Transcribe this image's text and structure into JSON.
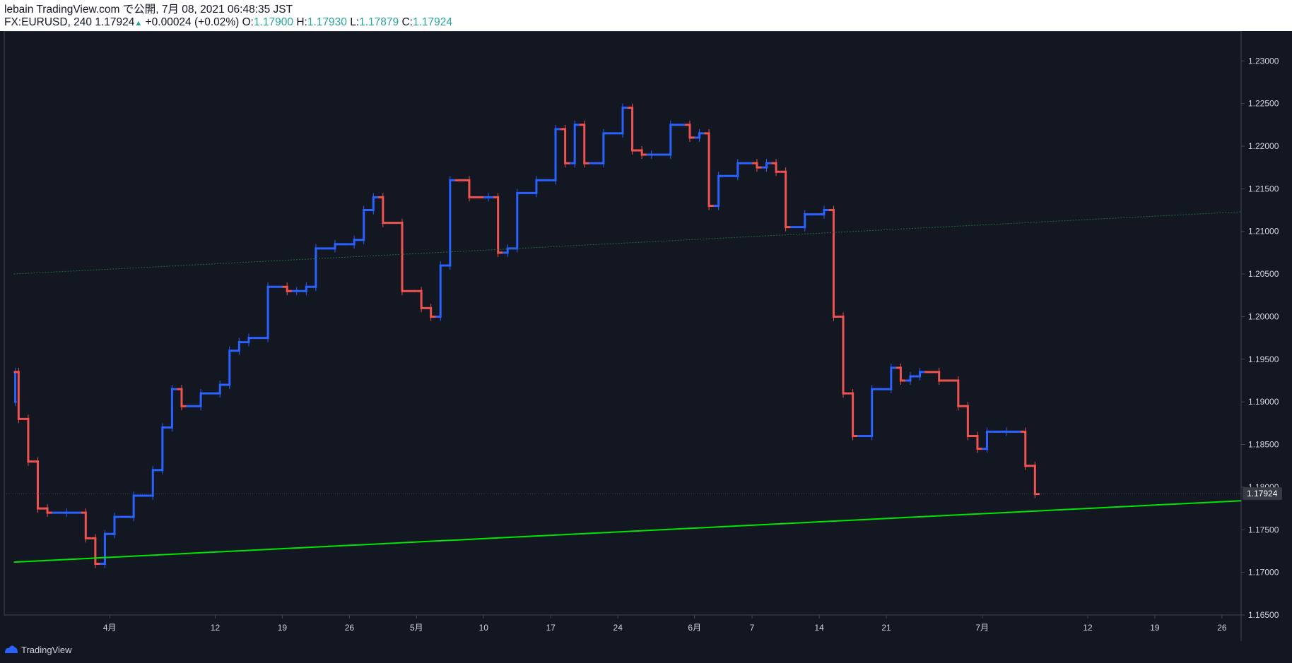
{
  "header": {
    "published": "lebain TradingView.com で公開, 7月 08, 2021 06:48:35 JST",
    "symbol": "FX:EURUSD, 240",
    "last": "1.17924",
    "change": "+0.00024 (+0.02%)",
    "o_label": "O:",
    "o_value": "1.17900",
    "h_label": "H:",
    "h_value": "1.17930",
    "l_label": "L:",
    "l_value": "1.17879",
    "c_label": "C:",
    "c_value": "1.17924"
  },
  "footer": {
    "brand": "TradingView",
    "logo_icon": "tradingview-logo-icon"
  },
  "colors": {
    "background": "#131722",
    "up": "#2962ff",
    "down": "#ef5350",
    "trendline": "#00e600",
    "reference_line": "#1e6b3a",
    "axis_text": "#d1d4dc",
    "price_label_bg": "#363a45"
  },
  "chart_data": {
    "type": "candlestick",
    "symbol": "FX:EURUSD",
    "interval": "240",
    "last_price": "1.17924",
    "ylim": [
      1.165,
      1.2335
    ],
    "x_ticks": [
      {
        "label": "4月",
        "date": "2021-04-01"
      },
      {
        "label": "12",
        "date": "2021-04-12"
      },
      {
        "label": "19",
        "date": "2021-04-19"
      },
      {
        "label": "26",
        "date": "2021-04-26"
      },
      {
        "label": "5月",
        "date": "2021-05-03"
      },
      {
        "label": "10",
        "date": "2021-05-10"
      },
      {
        "label": "17",
        "date": "2021-05-17"
      },
      {
        "label": "24",
        "date": "2021-05-24"
      },
      {
        "label": "6月",
        "date": "2021-06-01"
      },
      {
        "label": "7",
        "date": "2021-06-07"
      },
      {
        "label": "14",
        "date": "2021-06-14"
      },
      {
        "label": "21",
        "date": "2021-06-21"
      },
      {
        "label": "7月",
        "date": "2021-07-01"
      },
      {
        "label": "12",
        "date": "2021-07-12"
      },
      {
        "label": "19",
        "date": "2021-07-19"
      },
      {
        "label": "26",
        "date": "2021-07-26"
      }
    ],
    "y_ticks": [
      "1.23000",
      "1.22500",
      "1.22000",
      "1.21500",
      "1.21000",
      "1.20500",
      "1.20000",
      "1.19500",
      "1.19000",
      "1.18500",
      "1.18000",
      "1.17500",
      "1.17000",
      "1.16500"
    ],
    "price_path": [
      [
        "2021-03-22",
        1.19
      ],
      [
        "2021-03-22",
        1.1935
      ],
      [
        "2021-03-23",
        1.188
      ],
      [
        "2021-03-24",
        1.183
      ],
      [
        "2021-03-25",
        1.1775
      ],
      [
        "2021-03-26",
        1.177
      ],
      [
        "2021-03-29",
        1.177
      ],
      [
        "2021-03-30",
        1.174
      ],
      [
        "2021-03-31",
        1.171
      ],
      [
        "2021-04-01",
        1.1745
      ],
      [
        "2021-04-02",
        1.1765
      ],
      [
        "2021-04-05",
        1.179
      ],
      [
        "2021-04-06",
        1.182
      ],
      [
        "2021-04-07",
        1.187
      ],
      [
        "2021-04-08",
        1.1915
      ],
      [
        "2021-04-09",
        1.1895
      ],
      [
        "2021-04-12",
        1.191
      ],
      [
        "2021-04-13",
        1.192
      ],
      [
        "2021-04-14",
        1.196
      ],
      [
        "2021-04-15",
        1.197
      ],
      [
        "2021-04-16",
        1.1975
      ],
      [
        "2021-04-19",
        1.2035
      ],
      [
        "2021-04-20",
        1.203
      ],
      [
        "2021-04-21",
        1.203
      ],
      [
        "2021-04-22",
        1.2035
      ],
      [
        "2021-04-23",
        1.208
      ],
      [
        "2021-04-26",
        1.2085
      ],
      [
        "2021-04-27",
        1.209
      ],
      [
        "2021-04-28",
        1.2125
      ],
      [
        "2021-04-29",
        1.214
      ],
      [
        "2021-04-30",
        1.211
      ],
      [
        "2021-05-03",
        1.203
      ],
      [
        "2021-05-04",
        1.201
      ],
      [
        "2021-05-05",
        1.2
      ],
      [
        "2021-05-06",
        1.206
      ],
      [
        "2021-05-07",
        1.216
      ],
      [
        "2021-05-10",
        1.214
      ],
      [
        "2021-05-11",
        1.214
      ],
      [
        "2021-05-12",
        1.2075
      ],
      [
        "2021-05-13",
        1.208
      ],
      [
        "2021-05-14",
        1.2145
      ],
      [
        "2021-05-17",
        1.216
      ],
      [
        "2021-05-18",
        1.222
      ],
      [
        "2021-05-19",
        1.218
      ],
      [
        "2021-05-20",
        1.2225
      ],
      [
        "2021-05-21",
        1.218
      ],
      [
        "2021-05-24",
        1.2215
      ],
      [
        "2021-05-25",
        1.2245
      ],
      [
        "2021-05-26",
        1.2195
      ],
      [
        "2021-05-27",
        1.219
      ],
      [
        "2021-05-28",
        1.219
      ],
      [
        "2021-05-31",
        1.2225
      ],
      [
        "2021-06-01",
        1.221
      ],
      [
        "2021-06-02",
        1.2215
      ],
      [
        "2021-06-03",
        1.213
      ],
      [
        "2021-06-04",
        1.2165
      ],
      [
        "2021-06-07",
        1.218
      ],
      [
        "2021-06-08",
        1.2175
      ],
      [
        "2021-06-09",
        1.218
      ],
      [
        "2021-06-10",
        1.217
      ],
      [
        "2021-06-11",
        1.2105
      ],
      [
        "2021-06-14",
        1.212
      ],
      [
        "2021-06-15",
        1.2125
      ],
      [
        "2021-06-16",
        1.2
      ],
      [
        "2021-06-17",
        1.191
      ],
      [
        "2021-06-18",
        1.186
      ],
      [
        "2021-06-21",
        1.1915
      ],
      [
        "2021-06-22",
        1.194
      ],
      [
        "2021-06-23",
        1.1925
      ],
      [
        "2021-06-24",
        1.193
      ],
      [
        "2021-06-25",
        1.1935
      ],
      [
        "2021-06-28",
        1.1925
      ],
      [
        "2021-06-29",
        1.1895
      ],
      [
        "2021-06-30",
        1.186
      ],
      [
        "2021-07-01",
        1.1845
      ],
      [
        "2021-07-02",
        1.1865
      ],
      [
        "2021-07-05",
        1.1865
      ],
      [
        "2021-07-06",
        1.1825
      ],
      [
        "2021-07-07",
        1.1792
      ]
    ],
    "trendline": {
      "start": [
        "2021-03-22",
        1.1712
      ],
      "end": [
        "2021-07-28",
        1.1784
      ]
    },
    "reference_line": {
      "start": [
        "2021-03-22",
        1.205
      ],
      "end": [
        "2021-07-28",
        1.2123
      ]
    }
  }
}
